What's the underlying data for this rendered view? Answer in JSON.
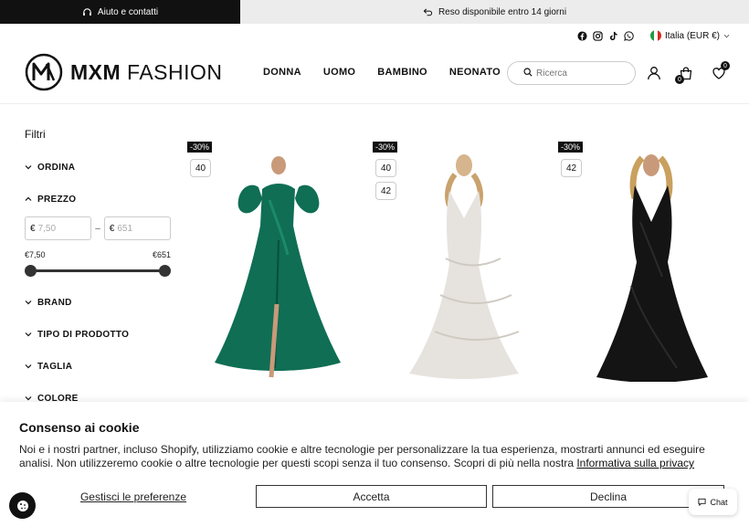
{
  "topbar": {
    "help_label": "Aiuto e contatti",
    "shipping_label": "Reso disponibile entro 14 giorni"
  },
  "header": {
    "brand_bold": "MXM",
    "brand_light": " FASHION",
    "locale_label": "Italia (EUR €)",
    "nav": [
      "DONNA",
      "UOMO",
      "BAMBINO",
      "NEONATO"
    ],
    "search_placeholder": "Ricerca",
    "cart_count": "0",
    "wishlist_count": "0"
  },
  "sidebar": {
    "title": "Filtri",
    "facets": {
      "sort": "ORDINA",
      "price": "PREZZO",
      "brand": "BRAND",
      "product_type": "TIPO DI PRODOTTO",
      "size": "TAGLIA",
      "color": "COLORE"
    },
    "price": {
      "currency": "€",
      "min_placeholder": "7,50",
      "max_placeholder": "651",
      "range_separator": "–",
      "min_label": "€7,50",
      "max_label": "€651",
      "slider_min_fraction": 0,
      "slider_max_fraction": 1
    }
  },
  "products": [
    {
      "discount": "-30%",
      "sizes": [
        "40"
      ],
      "color": "#0f6e54"
    },
    {
      "discount": "-30%",
      "sizes": [
        "40",
        "42"
      ],
      "color": "#e6e3de"
    },
    {
      "discount": "-30%",
      "sizes": [
        "42"
      ],
      "color": "#141414"
    }
  ],
  "cookie": {
    "title": "Consenso ai cookie",
    "text": "Noi e i nostri partner, incluso Shopify, utilizziamo cookie e altre tecnologie per personalizzare la tua esperienza, mostrarti annunci ed eseguire analisi. Non utilizzeremo cookie o altre tecnologie per questi scopi senza il tuo consenso. Scopri di più nella nostra ",
    "privacy_link": "Informativa sulla privacy",
    "manage_label": "Gestisci le preferenze",
    "accept_label": "Accetta",
    "decline_label": "Declina"
  },
  "chat": {
    "label": "Chat"
  },
  "colors": {
    "accent": "#111111",
    "topbar_light": "#ececec"
  }
}
